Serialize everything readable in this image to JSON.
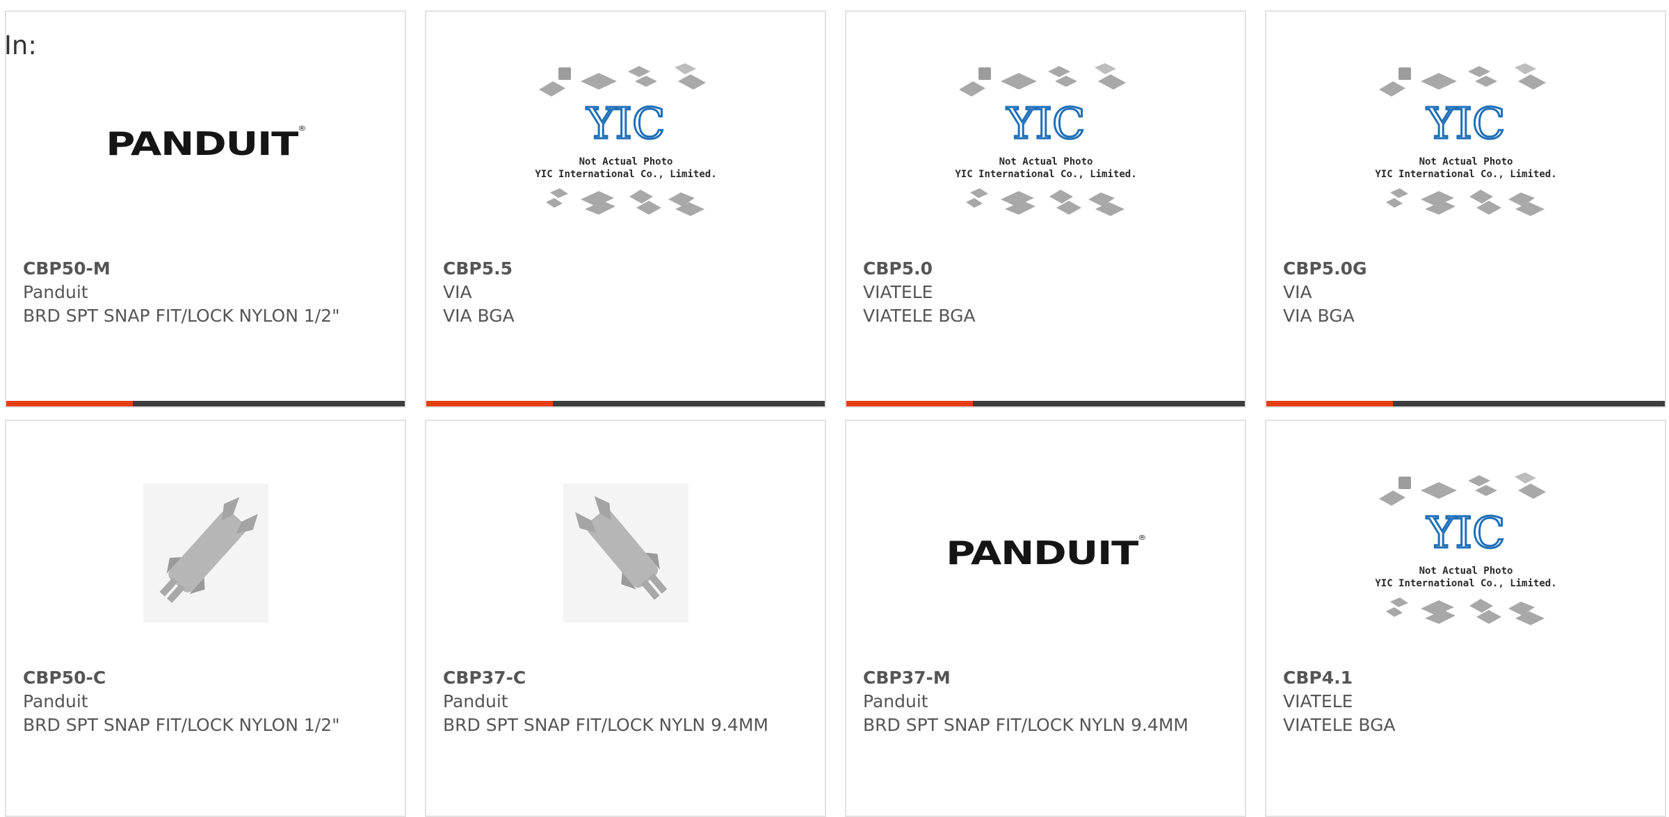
{
  "header": {
    "in_label": "In:"
  },
  "yic": {
    "line1": "Not Actual Photo",
    "line2": "YIC International Co., Limited.",
    "logo": "YIC"
  },
  "panduit_logo": "PANDUIT",
  "products": [
    {
      "part": "CBP50-M",
      "maker": "Panduit",
      "desc": "BRD SPT SNAP FIT/LOCK NYLON 1/2\"",
      "image": "panduit-logo"
    },
    {
      "part": "CBP5.5",
      "maker": "VIA",
      "desc": "VIA BGA",
      "image": "yic-placeholder"
    },
    {
      "part": "CBP5.0",
      "maker": "VIATELE",
      "desc": "VIATELE BGA",
      "image": "yic-placeholder"
    },
    {
      "part": "CBP5.0G",
      "maker": "VIA",
      "desc": "VIA BGA",
      "image": "yic-placeholder"
    },
    {
      "part": "CBP50-C",
      "maker": "Panduit",
      "desc": "BRD SPT SNAP FIT/LOCK NYLON 1/2\"",
      "image": "snap-spacer-photo"
    },
    {
      "part": "CBP37-C",
      "maker": "Panduit",
      "desc": "BRD SPT SNAP FIT/LOCK NYLN 9.4MM",
      "image": "snap-spacer-photo"
    },
    {
      "part": "CBP37-M",
      "maker": "Panduit",
      "desc": "BRD SPT SNAP FIT/LOCK NYLN 9.4MM",
      "image": "panduit-logo"
    },
    {
      "part": "CBP4.1",
      "maker": "VIATELE",
      "desc": "VIATELE BGA",
      "image": "yic-placeholder"
    }
  ],
  "colors": {
    "accent": "#e43e11",
    "bar": "#3d3d3d",
    "text": "#555555",
    "border": "#e2e2e2"
  }
}
